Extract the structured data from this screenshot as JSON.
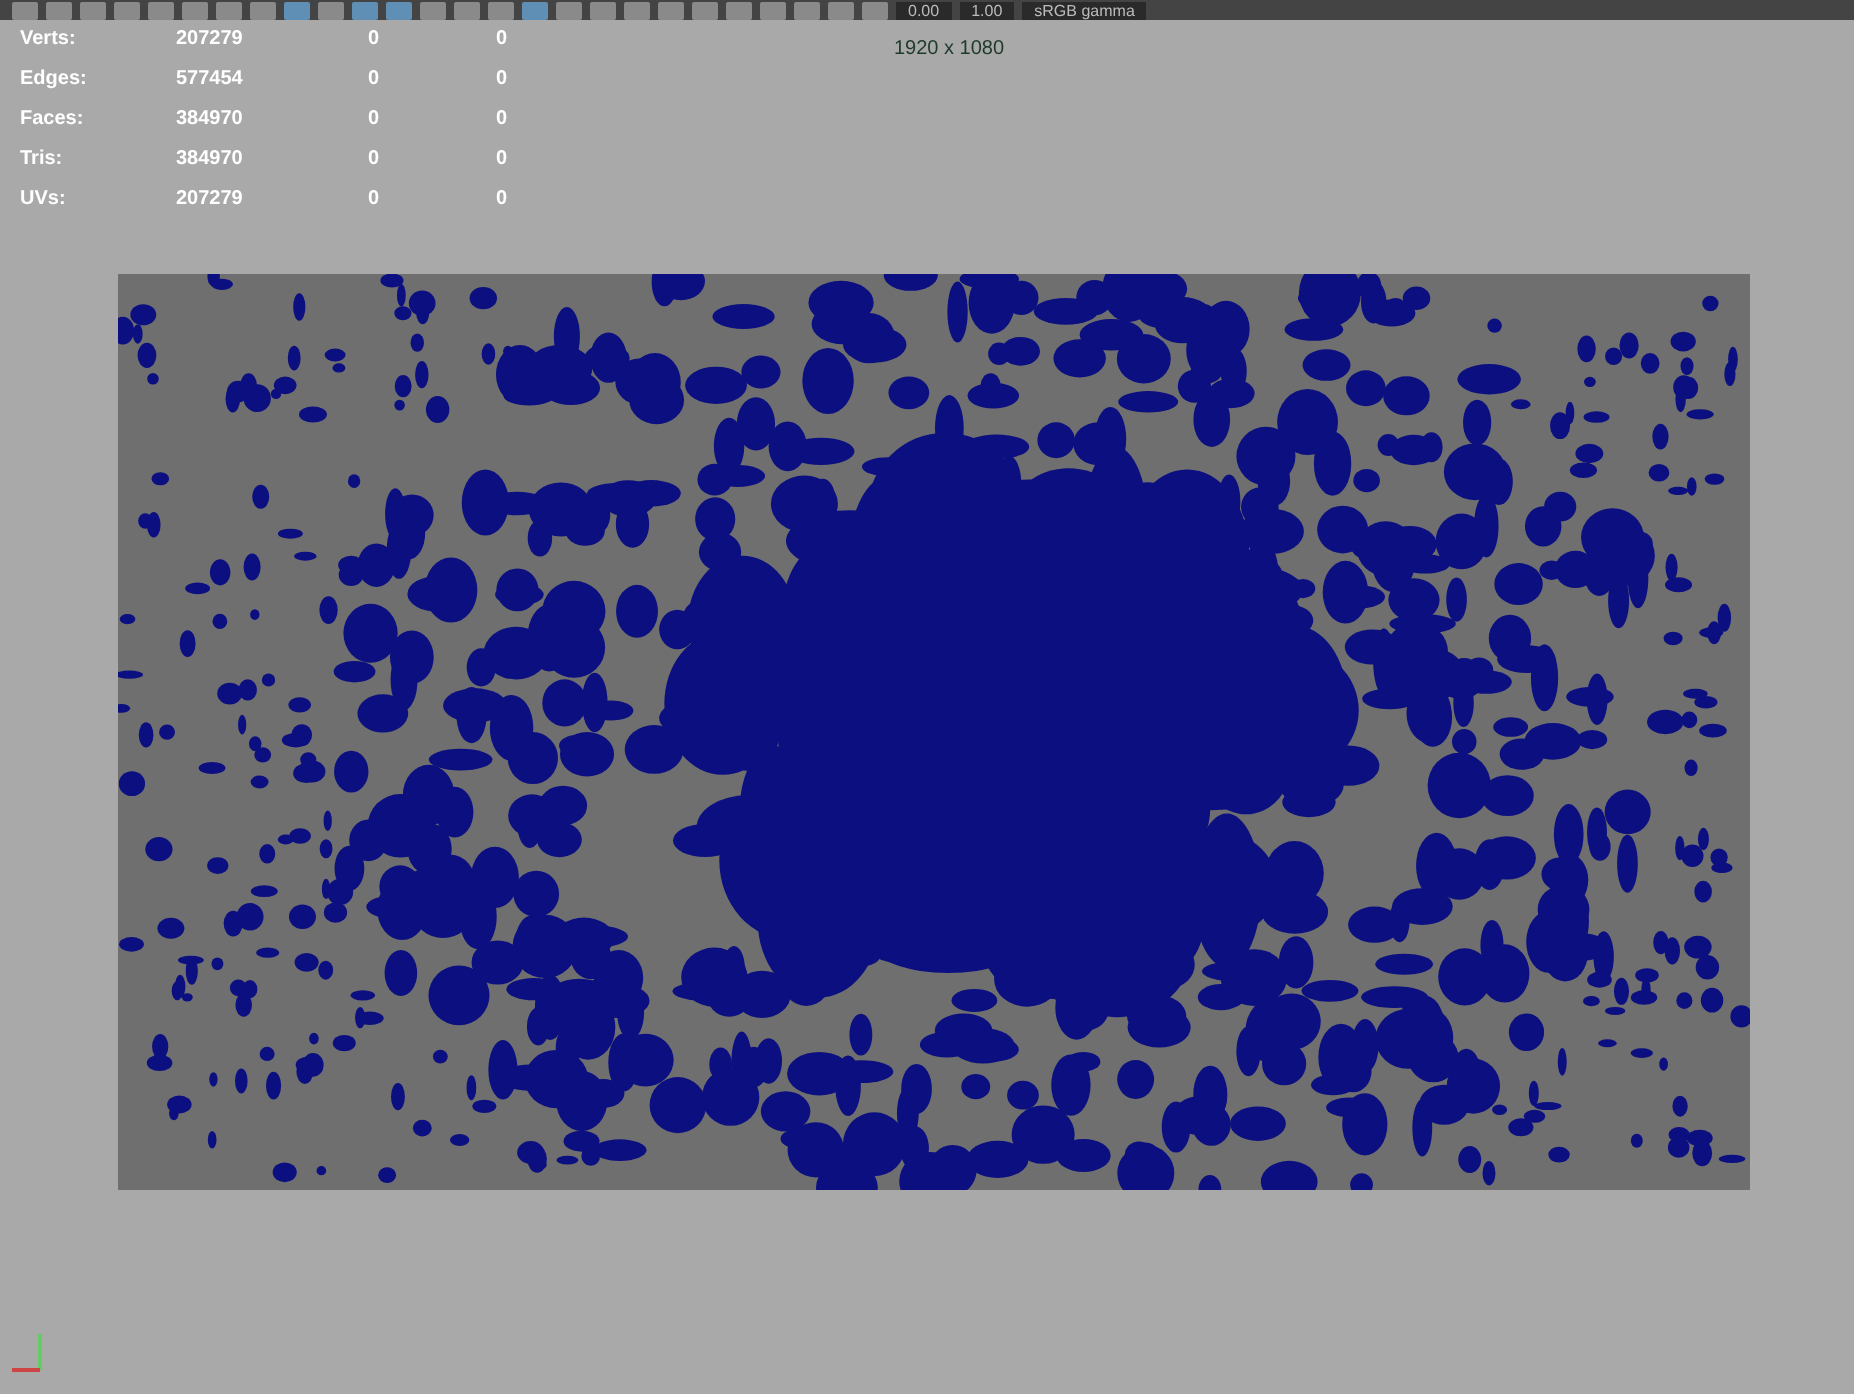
{
  "toolbar": {
    "icons": [
      {
        "selected": false
      },
      {
        "selected": false
      },
      {
        "selected": false
      },
      {
        "selected": false
      },
      {
        "selected": false
      },
      {
        "selected": false
      },
      {
        "selected": false
      },
      {
        "selected": false
      },
      {
        "selected": true
      },
      {
        "selected": false
      },
      {
        "selected": true
      },
      {
        "selected": true
      },
      {
        "selected": false
      },
      {
        "selected": false
      },
      {
        "selected": false
      },
      {
        "selected": true
      },
      {
        "selected": false
      },
      {
        "selected": false
      },
      {
        "selected": false
      },
      {
        "selected": false
      },
      {
        "selected": false
      },
      {
        "selected": false
      },
      {
        "selected": false
      },
      {
        "selected": false
      },
      {
        "selected": false
      },
      {
        "selected": false
      }
    ],
    "exposure": "0.00",
    "gamma": "1.00",
    "color_space": "sRGB gamma"
  },
  "stats": [
    {
      "label": "Verts:",
      "total": "207279",
      "selected": "0",
      "column_3": "0"
    },
    {
      "label": "Edges:",
      "total": "577454",
      "selected": "0",
      "column_3": "0"
    },
    {
      "label": "Faces:",
      "total": "384970",
      "selected": "0",
      "column_3": "0"
    },
    {
      "label": "Tris:",
      "total": "384970",
      "selected": "0",
      "column_3": "0"
    },
    {
      "label": "UVs:",
      "total": "207279",
      "selected": "0",
      "column_3": "0"
    }
  ],
  "resolution": "1920 x 1080"
}
